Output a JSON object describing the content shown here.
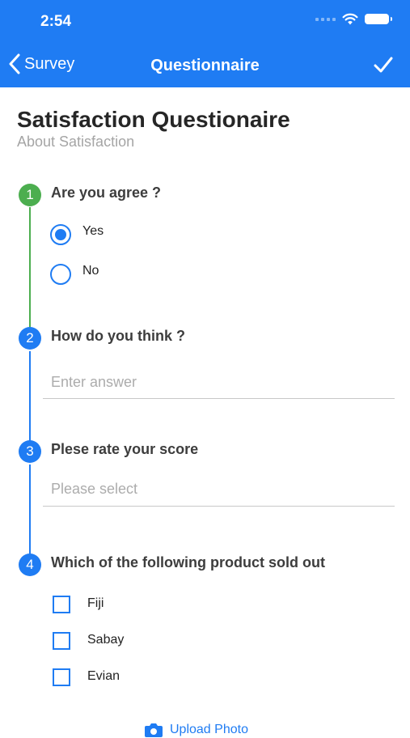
{
  "status_bar": {
    "time": "2:54"
  },
  "nav": {
    "back_label": "Survey",
    "title": "Questionnaire"
  },
  "page": {
    "title": "Satisfaction Questionaire",
    "subtitle": "About Satisfaction"
  },
  "questions": [
    {
      "number": "1",
      "label": "Are you agree ?",
      "options": [
        {
          "label": "Yes",
          "selected": true
        },
        {
          "label": "No",
          "selected": false
        }
      ]
    },
    {
      "number": "2",
      "label": "How do you think ?",
      "placeholder": "Enter answer"
    },
    {
      "number": "3",
      "label": "Plese rate your score",
      "placeholder": "Please select"
    },
    {
      "number": "4",
      "label": "Which of the following product sold out",
      "options": [
        {
          "label": "Fiji",
          "checked": false
        },
        {
          "label": "Sabay",
          "checked": false
        },
        {
          "label": "Evian",
          "checked": false
        }
      ]
    }
  ],
  "upload": {
    "label": "Upload Photo"
  },
  "colors": {
    "accent": "#1f7cf3",
    "completed": "#4cae4f",
    "header_bg": "#1f7cf3"
  }
}
